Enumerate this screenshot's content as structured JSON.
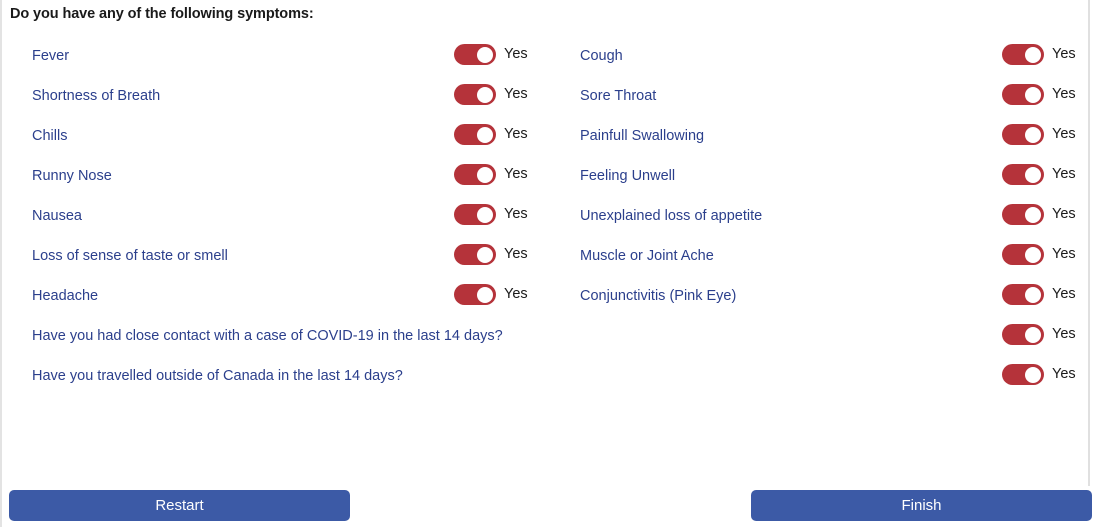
{
  "form": {
    "heading": "Do you have any of the following symptoms:"
  },
  "colors": {
    "toggle_on": "#b5333a",
    "link_blue": "#2b3f8c",
    "button_blue": "#3c5aa6",
    "heading_text": "#1a1a1a"
  },
  "symptoms": {
    "left_column": [
      {
        "label": "Fever",
        "toggle_value": "Yes",
        "state": "on"
      },
      {
        "label": "Shortness of Breath",
        "toggle_value": "Yes",
        "state": "on"
      },
      {
        "label": "Chills",
        "toggle_value": "Yes",
        "state": "on"
      },
      {
        "label": "Runny Nose",
        "toggle_value": "Yes",
        "state": "on"
      },
      {
        "label": "Nausea",
        "toggle_value": "Yes",
        "state": "on"
      },
      {
        "label": "Loss of sense of taste or smell",
        "toggle_value": "Yes",
        "state": "on"
      },
      {
        "label": "Headache",
        "toggle_value": "Yes",
        "state": "on"
      }
    ],
    "right_column": [
      {
        "label": "Cough",
        "toggle_value": "Yes",
        "state": "on"
      },
      {
        "label": "Sore Throat",
        "toggle_value": "Yes",
        "state": "on"
      },
      {
        "label": "Painfull Swallowing",
        "toggle_value": "Yes",
        "state": "on"
      },
      {
        "label": "Feeling Unwell",
        "toggle_value": "Yes",
        "state": "on"
      },
      {
        "label": "Unexplained loss of appetite",
        "toggle_value": "Yes",
        "state": "on"
      },
      {
        "label": "Muscle or Joint Ache",
        "toggle_value": "Yes",
        "state": "on"
      },
      {
        "label": "Conjunctivitis (Pink Eye)",
        "toggle_value": "Yes",
        "state": "on"
      }
    ]
  },
  "questions": [
    {
      "label": "Have you had close contact with a case of COVID-19 in the last 14 days?",
      "toggle_value": "Yes",
      "state": "on"
    },
    {
      "label": "Have you travelled outside of Canada in the last 14 days?",
      "toggle_value": "Yes",
      "state": "on"
    }
  ],
  "footer": {
    "restart_label": "Restart",
    "finish_label": "Finish"
  }
}
